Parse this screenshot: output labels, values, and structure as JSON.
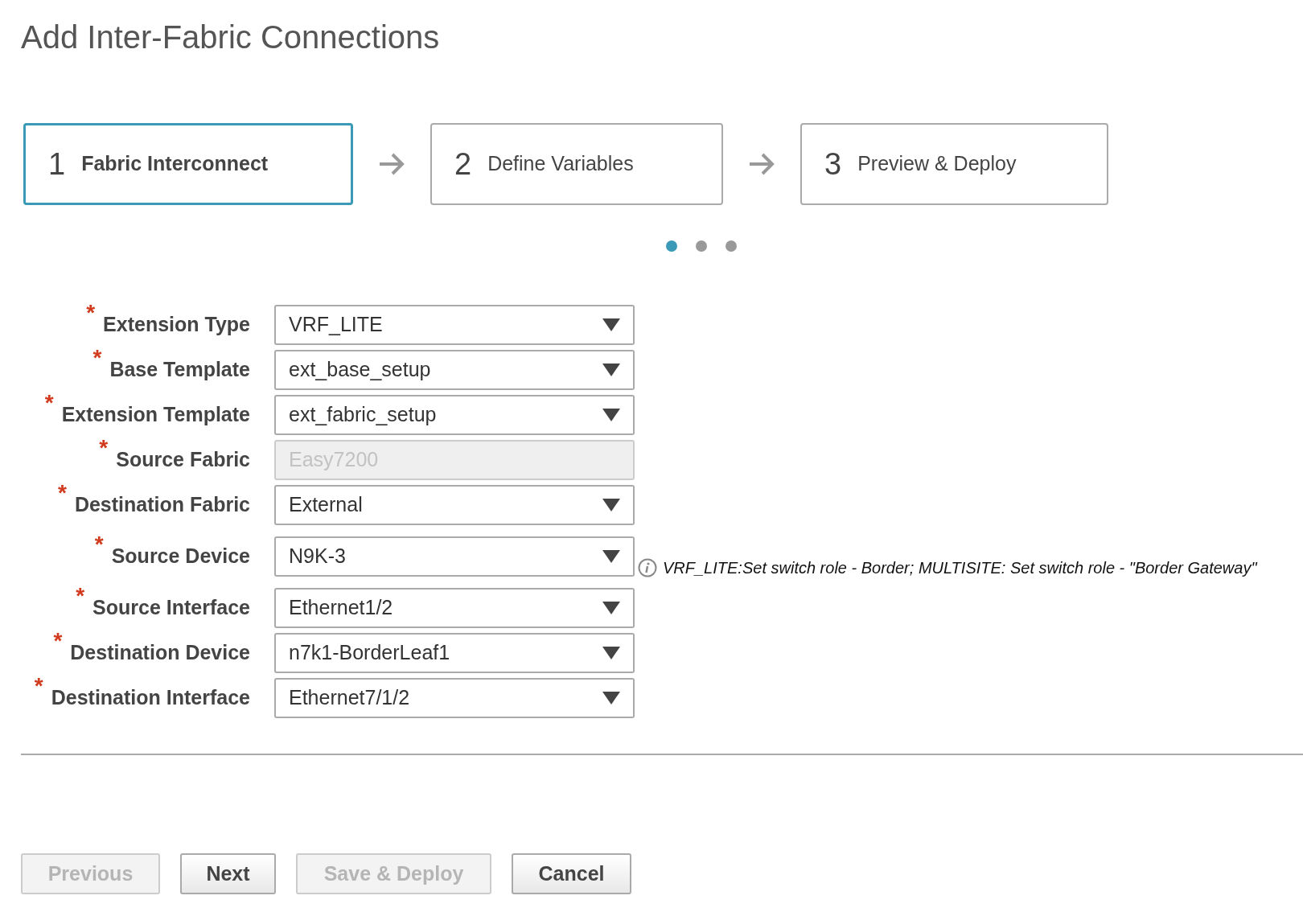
{
  "title": "Add Inter-Fabric Connections",
  "steps": [
    {
      "number": "1",
      "label": "Fabric Interconnect",
      "selected": true
    },
    {
      "number": "2",
      "label": "Define Variables",
      "selected": false
    },
    {
      "number": "3",
      "label": "Preview & Deploy",
      "selected": false
    }
  ],
  "step_dots": [
    {
      "selected": true
    },
    {
      "selected": false
    },
    {
      "selected": false
    }
  ],
  "fields": [
    {
      "label": "Extension Type",
      "required_mark": "*",
      "kind": "select",
      "value": "VRF_LITE",
      "disabled": false
    },
    {
      "label": "Base Template",
      "required_mark": "*",
      "kind": "select",
      "value": "ext_base_setup",
      "disabled": false
    },
    {
      "label": "Extension Template",
      "required_mark": "*",
      "kind": "select",
      "value": "ext_fabric_setup",
      "disabled": false
    },
    {
      "label": "Source Fabric",
      "required_mark": "*",
      "kind": "text",
      "value": "Easy7200",
      "disabled": true
    },
    {
      "label": "Destination Fabric",
      "required_mark": "*",
      "kind": "select",
      "value": "External",
      "disabled": false
    },
    {
      "label": "Source Device",
      "required_mark": "*",
      "kind": "select",
      "value": "N9K-3",
      "disabled": false,
      "hint": "VRF_LITE:Set switch role - Border; MULTISITE: Set switch role - \"Border Gateway\""
    },
    {
      "label": "Source Interface",
      "required_mark": "*",
      "kind": "select",
      "value": "Ethernet1/2",
      "disabled": false
    },
    {
      "label": "Destination Device",
      "required_mark": "*",
      "kind": "select",
      "value": "n7k1-BorderLeaf1",
      "disabled": false
    },
    {
      "label": "Destination Interface",
      "required_mark": "*",
      "kind": "select",
      "value": "Ethernet7/1/2",
      "disabled": false
    }
  ],
  "buttons": [
    {
      "label": "Previous",
      "disabled": true
    },
    {
      "label": "Next",
      "disabled": false
    },
    {
      "label": "Save & Deploy",
      "disabled": true
    },
    {
      "label": "Cancel",
      "disabled": false
    }
  ]
}
